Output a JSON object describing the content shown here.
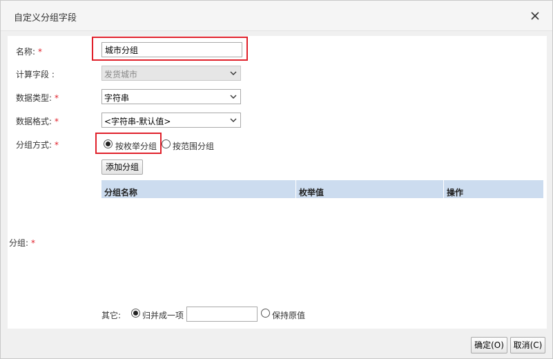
{
  "dialog": {
    "title": "自定义分组字段",
    "close_icon": "close-icon"
  },
  "form": {
    "name": {
      "label": "名称:",
      "required": "*",
      "value": "城市分组"
    },
    "calc_field": {
      "label": "计算字段 :",
      "value": "发货城市"
    },
    "data_type": {
      "label": "数据类型:",
      "required": "*",
      "value": "字符串"
    },
    "data_format": {
      "label": "数据格式:",
      "required": "*",
      "value": "<字符串-默认值>"
    },
    "group_method": {
      "label": "分组方式:",
      "required": "*",
      "options": [
        {
          "label": "按枚举分组",
          "checked": true
        },
        {
          "label": "按范围分组",
          "checked": false
        }
      ]
    },
    "add_group_button": "添加分组",
    "group": {
      "label": "分组:",
      "required": "*"
    },
    "table": {
      "columns": [
        "分组名称",
        "枚举值",
        "操作"
      ],
      "header_color": "#ccdcef"
    },
    "other": {
      "label": "其它:",
      "options": [
        {
          "label": "归并成一项",
          "checked": true
        },
        {
          "label": "保持原值",
          "checked": false
        }
      ],
      "merge_value": ""
    }
  },
  "footer": {
    "ok_label": "确定(O)",
    "cancel_label": "取消(C)"
  },
  "colors": {
    "required": "#e0202a",
    "highlight": "#e0202a"
  }
}
